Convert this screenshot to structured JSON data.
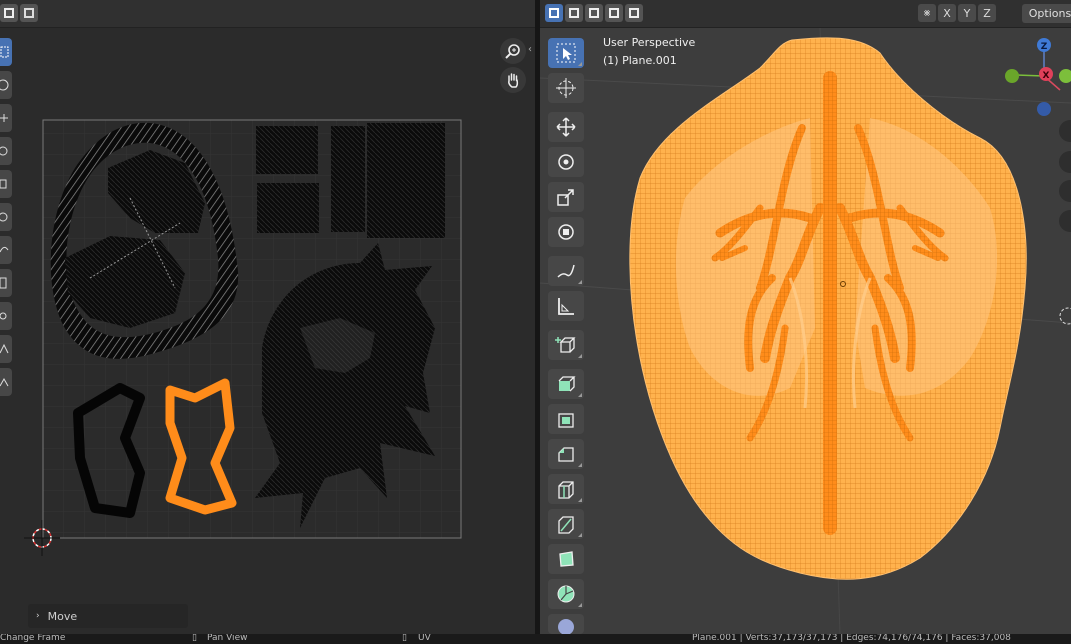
{
  "uv_editor": {
    "operator_panel": {
      "label": "Move"
    }
  },
  "viewport": {
    "overlay": {
      "perspective": "User Perspective",
      "object": "(1) Plane.001"
    },
    "axis_buttons": [
      "X",
      "Y",
      "Z"
    ],
    "options_label": "Options"
  },
  "statusbar": {
    "left_action": "Change Frame",
    "mid_action": "Pan View",
    "context": "UV",
    "stats": "Plane.001 | Verts:37,173/37,173 | Edges:74,176/74,176 | Faces:37,008"
  },
  "colors": {
    "accent": "#4772b3",
    "mesh_orange": "#ffa33a",
    "selected_orange": "#ff8c1a",
    "uv_background": "#2b2b2b",
    "viewport_background": "#3d3d3d"
  }
}
